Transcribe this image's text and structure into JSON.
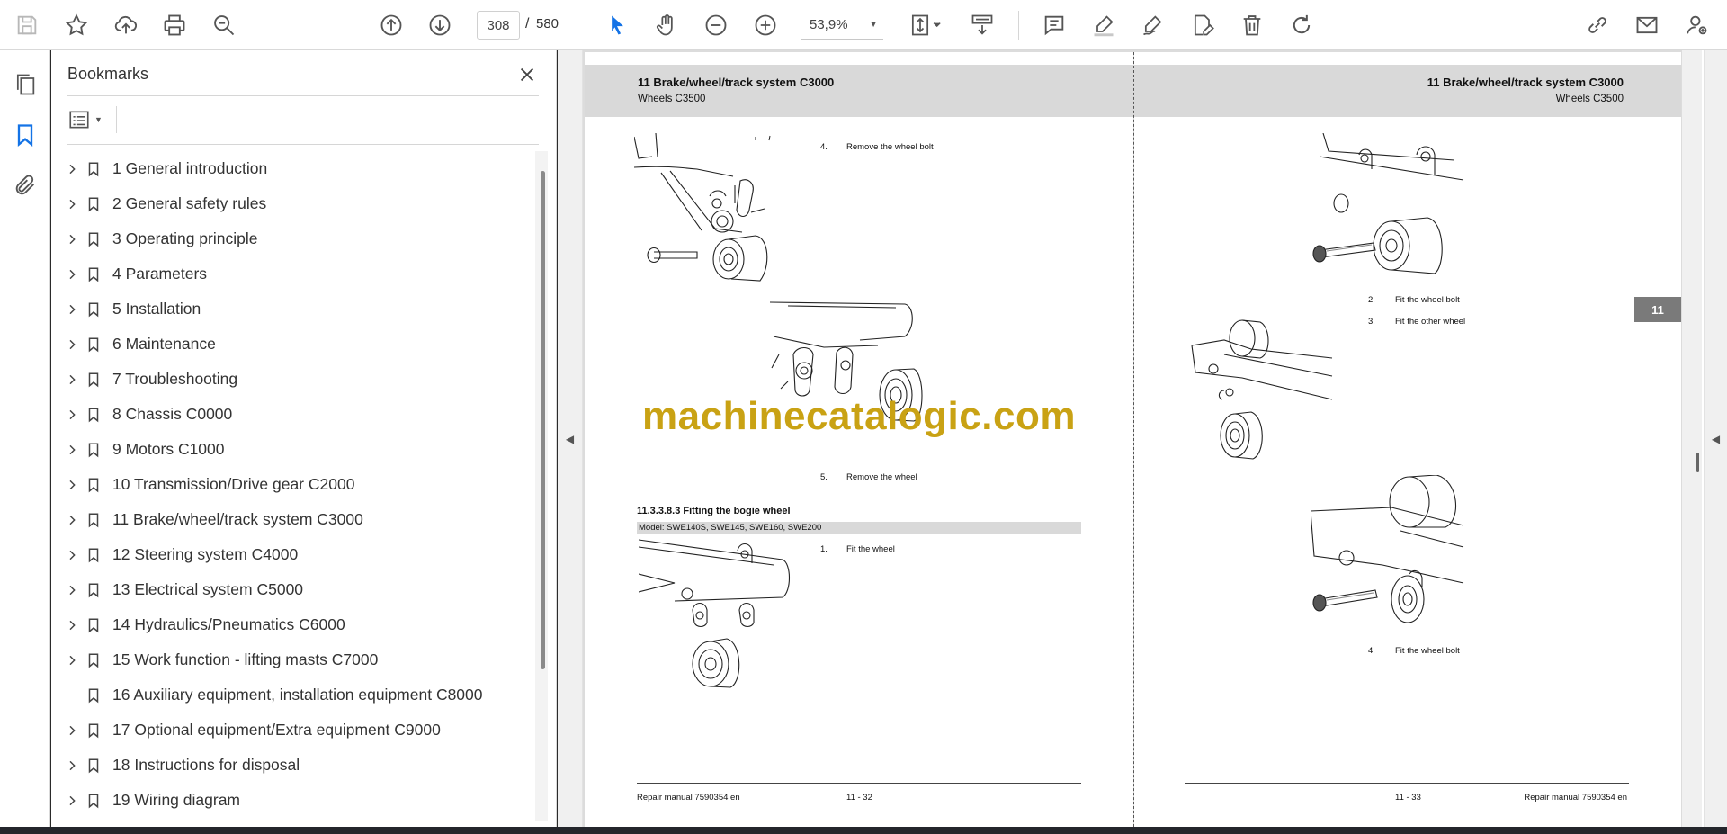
{
  "toolbar": {
    "page_current": "308",
    "page_separator": "/",
    "page_total": "580",
    "zoom": "53,9%",
    "icons": [
      "save-icon",
      "star-icon",
      "upload-icon",
      "print-icon",
      "zoom-search-icon",
      "page-up-icon",
      "page-down-icon",
      "select-cursor-icon",
      "hand-icon",
      "zoom-out-icon",
      "zoom-in-icon",
      "fit-page-icon",
      "scroll-mode-icon",
      "comment-icon",
      "highlight-icon",
      "sign-icon",
      "fill-sign-icon",
      "delete-icon",
      "rotate-icon",
      "share-link-icon",
      "email-icon",
      "account-icon"
    ]
  },
  "nav": {
    "icons": [
      "pages-icon",
      "bookmarks-icon",
      "attachments-icon"
    ]
  },
  "bookmarks": {
    "title": "Bookmarks",
    "items": [
      {
        "label": "1 General introduction",
        "expandable": true
      },
      {
        "label": "2 General safety rules",
        "expandable": true
      },
      {
        "label": "3 Operating principle",
        "expandable": true
      },
      {
        "label": "4 Parameters",
        "expandable": true
      },
      {
        "label": "5 Installation",
        "expandable": true
      },
      {
        "label": "6 Maintenance",
        "expandable": true
      },
      {
        "label": "7 Troubleshooting",
        "expandable": true
      },
      {
        "label": "8 Chassis C0000",
        "expandable": true
      },
      {
        "label": "9 Motors C1000",
        "expandable": true
      },
      {
        "label": "10 Transmission/Drive gear C2000",
        "expandable": true
      },
      {
        "label": "11 Brake/wheel/track system C3000",
        "expandable": true
      },
      {
        "label": "12 Steering system C4000",
        "expandable": true
      },
      {
        "label": "13 Electrical system C5000",
        "expandable": true
      },
      {
        "label": "14 Hydraulics/Pneumatics C6000",
        "expandable": true
      },
      {
        "label": "15 Work function - lifting masts C7000",
        "expandable": true
      },
      {
        "label": "16 Auxiliary equipment, installation equipment C8000",
        "expandable": false
      },
      {
        "label": "17 Optional equipment/Extra equipment C9000",
        "expandable": true
      },
      {
        "label": "18 Instructions for disposal",
        "expandable": true
      },
      {
        "label": "19 Wiring diagram",
        "expandable": true
      }
    ]
  },
  "document": {
    "left_page": {
      "header_title": "11 Brake/wheel/track system C3000",
      "header_sub": "Wheels C3500",
      "step4_num": "4.",
      "step4_text": "Remove the wheel bolt",
      "step5_num": "5.",
      "step5_text": "Remove the wheel",
      "section_title": "11.3.3.8.3 Fitting the bogie wheel",
      "model_line": "Model: SWE140S, SWE145, SWE160, SWE200",
      "step1_num": "1.",
      "step1_text": "Fit the wheel",
      "footer_left": "Repair manual 7590354 en",
      "footer_page": "11 - 32"
    },
    "right_page": {
      "header_title": "11 Brake/wheel/track system C3000",
      "header_sub": "Wheels C3500",
      "step2_num": "2.",
      "step2_text": "Fit the wheel bolt",
      "step3_num": "3.",
      "step3_text": "Fit the other wheel",
      "step4_num": "4.",
      "step4_text": "Fit the wheel bolt",
      "chapter_tab": "11",
      "footer_page": "11 - 33",
      "footer_right": "Repair manual 7590354 en"
    },
    "watermark": "machinecatalogic.com"
  },
  "colors": {
    "watermark": "#c9a214",
    "header_band": "#d9d9d9",
    "chapter_tab": "#7a7a7a",
    "accent_blue": "#1473e6"
  }
}
